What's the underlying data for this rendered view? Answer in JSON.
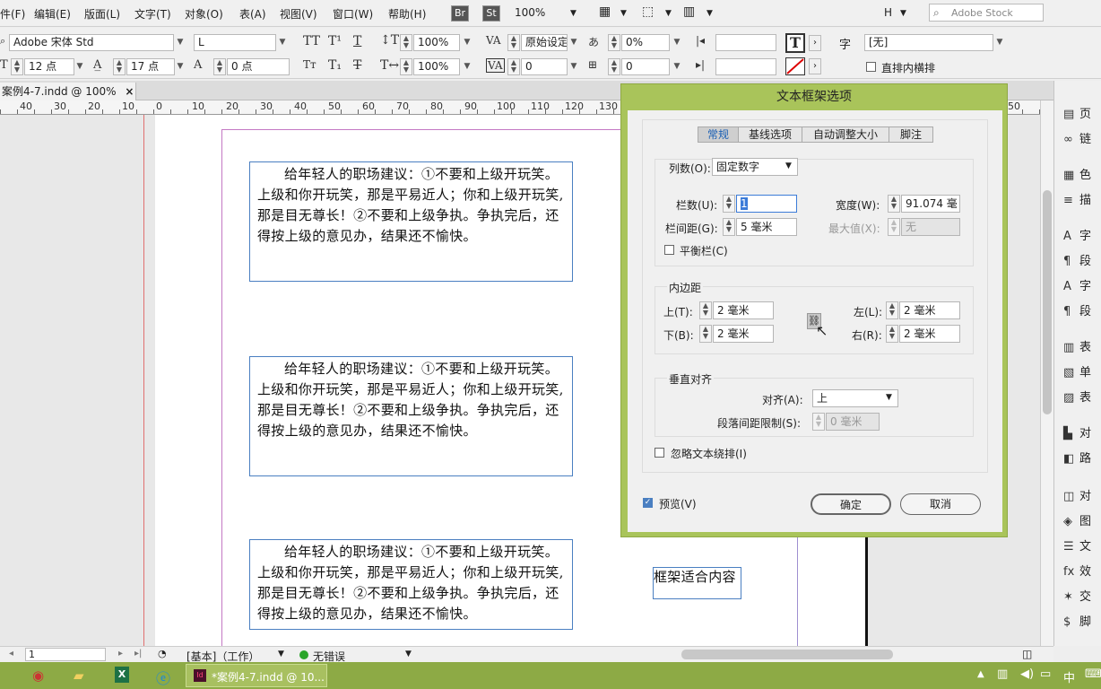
{
  "menu": [
    "件(F)",
    "编辑(E)",
    "版面(L)",
    "文字(T)",
    "对象(O)",
    "表(A)",
    "视图(V)",
    "窗口(W)",
    "帮助(H)"
  ],
  "menubar": {
    "br_label": "Br",
    "st_label": "St",
    "zoom": "100%",
    "workspace": "H",
    "search_placeholder": "Adobe Stock"
  },
  "control": {
    "font_family": "Adobe 宋体 Std",
    "font_style": "L",
    "font_size": "12 点",
    "leading": "17 点",
    "kerning_value": "0 点",
    "vscale": "100%",
    "hscale": "100%",
    "kerning_mode": "原始设定",
    "tracking": "0",
    "tracking_pct": "0%",
    "baseline": "0",
    "char_style": "[无]",
    "vertical_label": "直排内横排",
    "lang_label": "字"
  },
  "tab": {
    "title": "案例4-7.indd @ 100%",
    "close": "×"
  },
  "ruler": [
    "40",
    "30",
    "20",
    "10",
    "0",
    "10",
    "20",
    "30",
    "40",
    "50",
    "60",
    "70",
    "80",
    "90",
    "100",
    "110",
    "120",
    "130",
    "50"
  ],
  "frames": {
    "text": "给年轻人的职场建议：①不要和上级开玩笑。上级和你开玩笑，那是平易近人；你和上级开玩笑,那是目无尊长！②不要和上级争执。争执完后，还得按上级的意见办，结果还不愉快。",
    "fit_label": "框架适合内容"
  },
  "right_panel": [
    {
      "icon": "▤",
      "label": "页"
    },
    {
      "icon": "∞",
      "label": "链"
    },
    {
      "icon": "▦",
      "label": "色"
    },
    {
      "icon": "≡",
      "label": "描"
    },
    {
      "icon": "A",
      "label": "字"
    },
    {
      "icon": "¶",
      "label": "段"
    },
    {
      "icon": "A",
      "label": "字"
    },
    {
      "icon": "¶",
      "label": "段"
    },
    {
      "icon": "▥",
      "label": "表"
    },
    {
      "icon": "▧",
      "label": "单"
    },
    {
      "icon": "▨",
      "label": "表"
    },
    {
      "icon": "▙",
      "label": "对"
    },
    {
      "icon": "◧",
      "label": "路"
    },
    {
      "icon": "◫",
      "label": "对"
    },
    {
      "icon": "◈",
      "label": "图"
    },
    {
      "icon": "☰",
      "label": "文"
    },
    {
      "icon": "fx",
      "label": "效"
    },
    {
      "icon": "✶",
      "label": "交"
    },
    {
      "icon": "$",
      "label": "脚"
    }
  ],
  "status": {
    "page": "1",
    "mode": "[基本]（工作）",
    "errors": "无错误"
  },
  "taskbar": {
    "app_title": "*案例4-7.indd @ 10...",
    "ime": "中"
  },
  "dialog": {
    "title": "文本框架选项",
    "tabs": [
      "常规",
      "基线选项",
      "自动调整大小",
      "脚注"
    ],
    "columns_label": "列数(O):",
    "columns_type": "固定数字",
    "count_label": "栏数(U):",
    "count_value": "1",
    "width_label": "宽度(W):",
    "width_value": "91.074 毫",
    "gutter_label": "栏间距(G):",
    "gutter_value": "5 毫米",
    "max_label": "最大值(X):",
    "max_value": "无",
    "balance_label": "平衡栏(C)",
    "inset_title": "内边距",
    "top_label": "上(T):",
    "top_value": "2 毫米",
    "bottom_label": "下(B):",
    "bottom_value": "2 毫米",
    "left_label": "左(L):",
    "left_value": "2 毫米",
    "right_label": "右(R):",
    "right_value": "2 毫米",
    "valign_title": "垂直对齐",
    "align_label": "对齐(A):",
    "align_value": "上",
    "para_limit_label": "段落间距限制(S):",
    "para_limit_value": "0 毫米",
    "ignore_wrap_label": "忽略文本绕排(I)",
    "preview_label": "预览(V)",
    "ok": "确定",
    "cancel": "取消"
  }
}
